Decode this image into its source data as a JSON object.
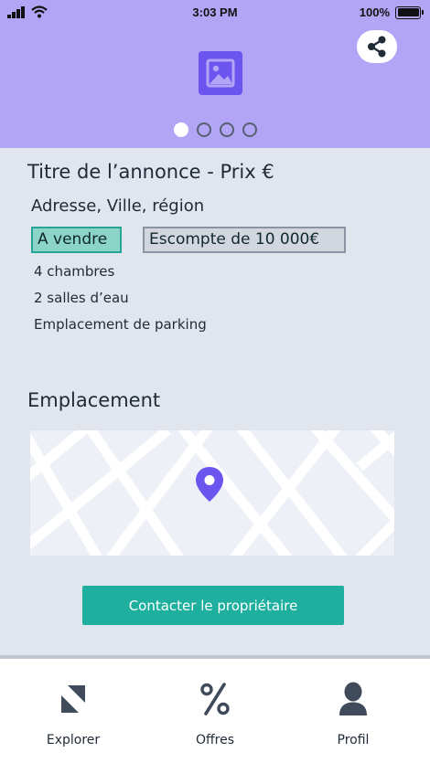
{
  "status_bar": {
    "time": "3:03 PM",
    "battery": "100%"
  },
  "gallery": {
    "image_icon": "image-icon",
    "share_icon": "share-icon",
    "slides_total": 4,
    "active_slide": 1
  },
  "listing": {
    "title": "Titre de l’annonce - Prix €",
    "address": "Adresse, Ville, région",
    "badge_status": "A vendre",
    "badge_discount": "Escompte de 10 000€",
    "features": [
      "4 chambres",
      "2 salles d’eau",
      "Emplacement de parking"
    ]
  },
  "location": {
    "title": "Emplacement",
    "pin_icon": "map-pin-icon"
  },
  "contact_button": "Contacter le propriétaire",
  "tabs": [
    {
      "label": "Explorer",
      "icon": "explore-icon"
    },
    {
      "label": "Offres",
      "icon": "percent-icon"
    },
    {
      "label": "Profil",
      "icon": "user-icon"
    }
  ],
  "colors": {
    "accent": "#6c55ef",
    "hero_bg": "#b3a5f6",
    "primary_button": "#1faf9e",
    "page_bg": "#e1e5ee"
  }
}
